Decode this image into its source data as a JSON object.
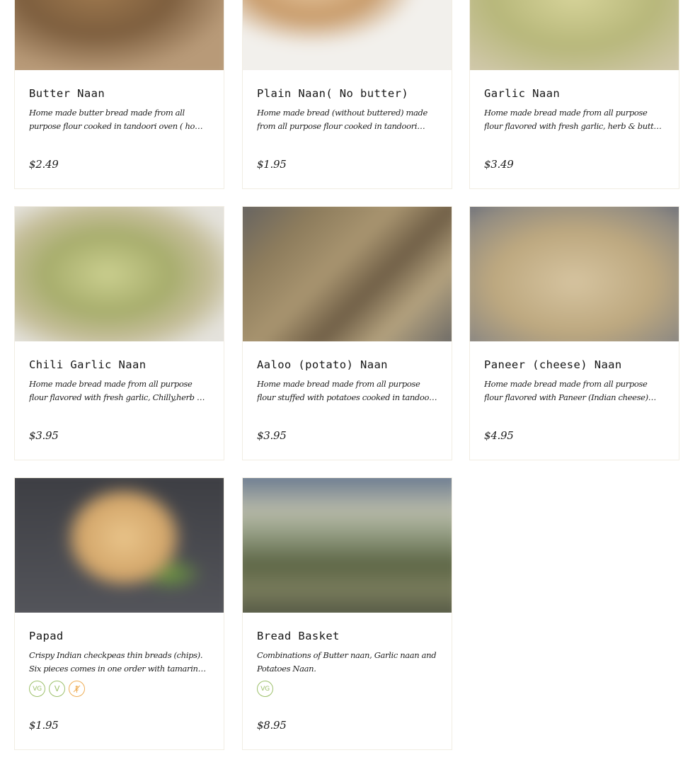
{
  "menu": {
    "items": [
      {
        "name": "Butter Naan",
        "description": "Home made butter bread made from all purpose flour cooked in tandoori oven ( home style cla...",
        "price": "$2.49",
        "badges": []
      },
      {
        "name": "Plain Naan( No butter)",
        "description": "Home made bread (without buttered) made from all purpose flour cooked in tandoori oven ...",
        "price": "$1.95",
        "badges": []
      },
      {
        "name": "Garlic Naan",
        "description": "Home made bread made from all purpose flour flavored with fresh garlic, herb & butter cooke...",
        "price": "$3.49",
        "badges": []
      },
      {
        "name": "Chili Garlic Naan",
        "description": "Home made bread made from all purpose flour flavored with fresh garlic, Chilly,herb & butter...",
        "price": "$3.95",
        "badges": []
      },
      {
        "name": "Aaloo (potato) Naan",
        "description": "Home made bread made from all purpose flour stuffed with potatoes cooked in tandoori oven (...",
        "price": "$3.95",
        "badges": []
      },
      {
        "name": "Paneer (cheese) Naan",
        "description": "Home made bread made from all purpose flour flavored with Paneer (Indian cheese) cooked in...",
        "price": "$4.95",
        "badges": []
      },
      {
        "name": "Papad",
        "description": "Crispy Indian checkpeas thin breads (chips). Six pieces comes in one order with tamarined sauc...",
        "price": "$1.95",
        "badges": [
          {
            "label": "VG",
            "icon": "vegan-icon"
          },
          {
            "label": "V",
            "icon": "vegetarian-icon"
          },
          {
            "label": "",
            "icon": "gluten-free-icon"
          }
        ]
      },
      {
        "name": "Bread Basket",
        "description": "Combinations of Butter naan, Garlic naan and Potatoes Naan.",
        "price": "$8.95",
        "badges": [
          {
            "label": "VG",
            "icon": "vegan-icon"
          }
        ]
      }
    ]
  },
  "colors": {
    "card_border": "#f1ede3",
    "badge_green": "#9dc06b",
    "badge_orange": "#eeae57",
    "text": "#1c1c1c"
  }
}
